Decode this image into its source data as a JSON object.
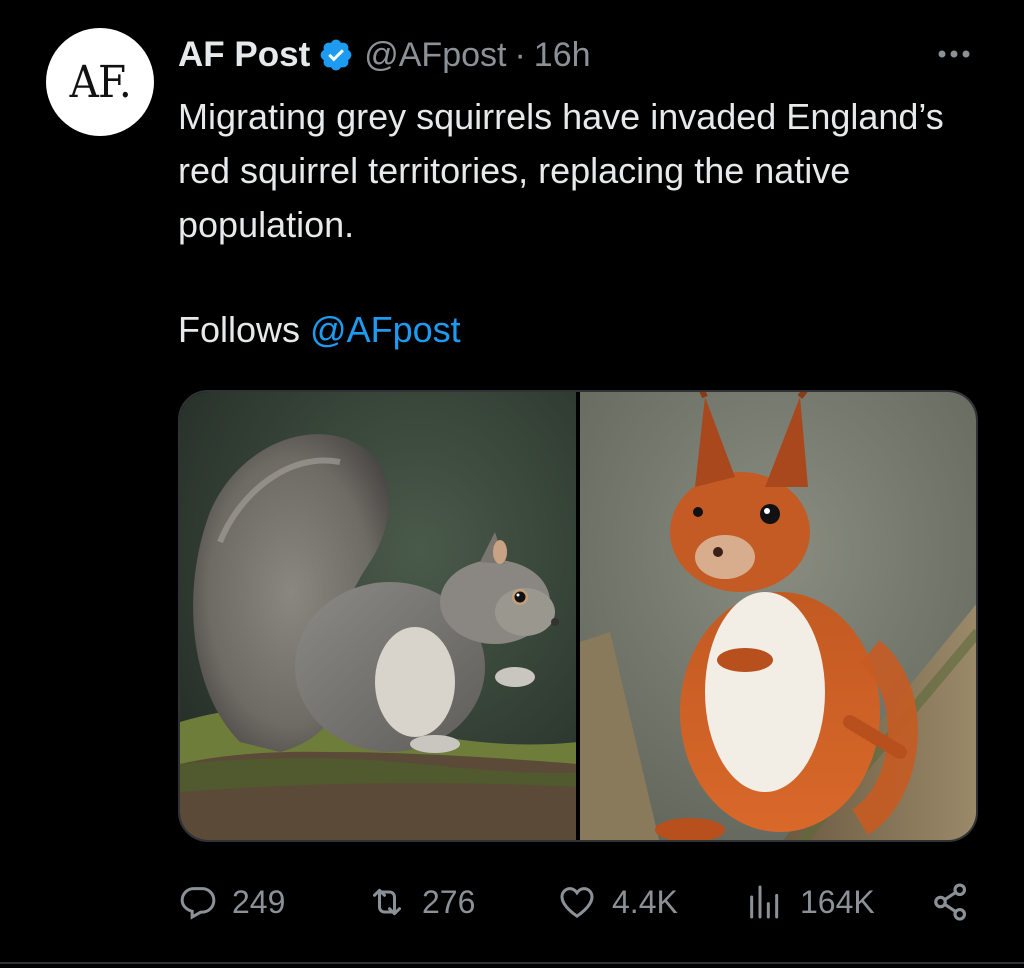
{
  "author": {
    "avatar_text": "AF.",
    "display_name": "AF Post",
    "handle": "@AFpost",
    "separator": "·",
    "time": "16h",
    "verified_color": "#1d9bf0"
  },
  "tweet": {
    "text": "Migrating grey squirrels have invaded England’s red squirrel territories, replacing the native population.",
    "follows_label": "Follows",
    "follows_handle": "@AFpost"
  },
  "media": {
    "items": [
      {
        "subject": "grey squirrel on mossy log"
      },
      {
        "subject": "red squirrel on tree branch"
      }
    ]
  },
  "actions": {
    "reply_count": "249",
    "repost_count": "276",
    "like_count": "4.4K",
    "views_count": "164K"
  },
  "colors": {
    "background": "#000000",
    "text": "#e7e9ea",
    "secondary": "#8b9197",
    "link": "#1d9bf0"
  },
  "icons": [
    "more-icon",
    "verified-icon",
    "reply-icon",
    "repost-icon",
    "like-icon",
    "views-icon",
    "share-icon"
  ]
}
